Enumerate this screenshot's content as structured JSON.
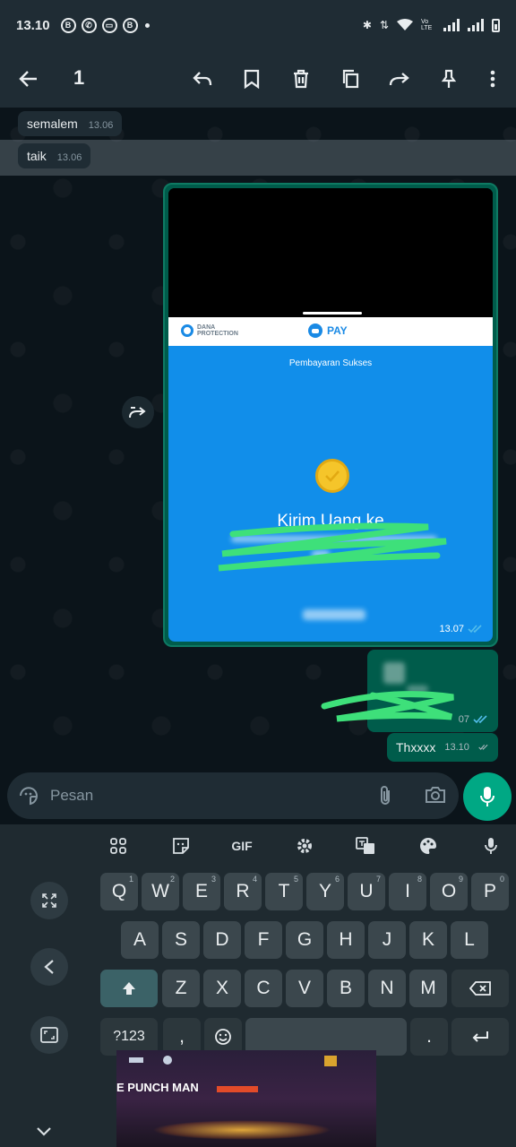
{
  "status_bar": {
    "time": "13.10",
    "left_icons": [
      "b-icon",
      "whatsapp-icon",
      "message-icon",
      "b-icon"
    ],
    "network_label": "Vo LTE"
  },
  "action_bar": {
    "selected_count": "1",
    "actions": [
      "back-arrow-icon",
      "reply-icon",
      "star-icon",
      "delete-icon",
      "copy-icon",
      "forward-icon",
      "pin-icon",
      "more-icon"
    ]
  },
  "chat": {
    "messages_in": [
      {
        "text": "semalem",
        "time": "13.06"
      },
      {
        "text": "taik",
        "time": "13.06"
      }
    ],
    "image_message": {
      "header_left": "DANA PROTECTION",
      "header_center": "PAY",
      "status": "Pembayaran Sukses",
      "headline": "Kirim Uang ke",
      "time": "13.07"
    },
    "partial_message": {
      "time": "07"
    },
    "last_message": {
      "text": "Thxxxx",
      "time": "13.10"
    }
  },
  "input": {
    "placeholder": "Pesan"
  },
  "keyboard": {
    "toolbar": [
      "apps-icon",
      "sticker-icon",
      "GIF",
      "settings-icon",
      "translate-icon",
      "palette-icon",
      "mic-icon"
    ],
    "gif_label": "GIF",
    "row1": [
      {
        "k": "Q",
        "h": "1"
      },
      {
        "k": "W",
        "h": "2"
      },
      {
        "k": "E",
        "h": "3"
      },
      {
        "k": "R",
        "h": "4"
      },
      {
        "k": "T",
        "h": "5"
      },
      {
        "k": "Y",
        "h": "6"
      },
      {
        "k": "U",
        "h": "7"
      },
      {
        "k": "I",
        "h": "8"
      },
      {
        "k": "O",
        "h": "9"
      },
      {
        "k": "P",
        "h": "0"
      }
    ],
    "row2": [
      "A",
      "S",
      "D",
      "F",
      "G",
      "H",
      "J",
      "K",
      "L"
    ],
    "row3": [
      "Z",
      "X",
      "C",
      "V",
      "B",
      "N",
      "M"
    ],
    "symbols_label": "?123",
    "comma_label": ",",
    "period_label": ".",
    "overlay_text": "E PUNCH MAN"
  },
  "colors": {
    "background": "#0b141a",
    "bar": "#1f2c34",
    "outgoing_bubble": "#005c4b",
    "accent": "#00a884",
    "dana_blue": "#118eea",
    "tick_blue": "#53bdeb"
  }
}
